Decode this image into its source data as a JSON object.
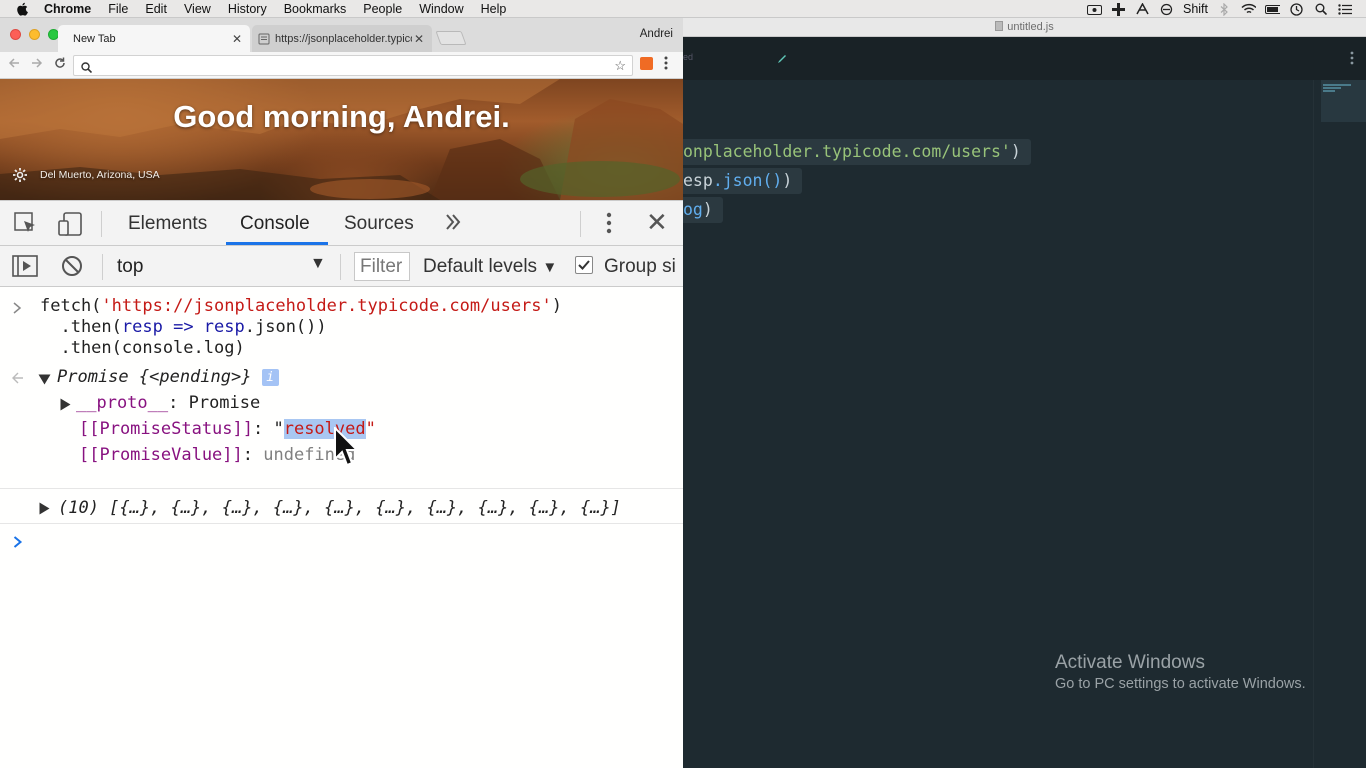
{
  "menubar": {
    "app_name": "Chrome",
    "items": [
      "File",
      "Edit",
      "View",
      "History",
      "Bookmarks",
      "People",
      "Window",
      "Help"
    ],
    "shift_label": "Shift"
  },
  "browser": {
    "tabs": [
      {
        "label": "New Tab",
        "active": true
      },
      {
        "label": "https://jsonplaceholder.typicode.com",
        "active": false
      }
    ],
    "profile_name": "Andrei",
    "address_value": ""
  },
  "newtab_page": {
    "greeting": "Good morning, Andrei.",
    "location": "Del Muerto, Arizona, USA"
  },
  "devtools": {
    "tabs": [
      "Elements",
      "Console",
      "Sources"
    ],
    "active_tab": "Console",
    "context": "top",
    "filter_placeholder": "Filter",
    "levels": "Default levels",
    "group_label": "Group si",
    "group_checked": true
  },
  "console": {
    "input_line1_fn": "fetch(",
    "input_line1_url": "'https://jsonplaceholder.typicode.com/users'",
    "input_line1_end": ")",
    "input_line2_a": "  .then(",
    "input_line2_b": "resp",
    "input_line2_c": " => ",
    "input_line2_d": "resp",
    "input_line2_e": ".json())",
    "input_line3": "  .then(console.log)",
    "promise_label": "Promise {<pending>}",
    "info_badge": "i",
    "proto_key": "__proto__",
    "proto_val": ": Promise",
    "status_key": "[[PromiseStatus]]",
    "status_sep": ": \"",
    "status_val": "resolved",
    "status_end": "\"",
    "value_key": "[[PromiseValue]]",
    "value_sep": ": ",
    "value_val": "undefined",
    "array_summary": "(10) [{…}, {…}, {…}, {…}, {…}, {…}, {…}, {…}, {…}, {…}]"
  },
  "editor": {
    "file_title": "untitled.js",
    "tab_fragment": "ed",
    "line1_str": "onplaceholder.typicode.com/users'",
    "line1_end": ")",
    "line2_a": "esp",
    "line2_b": ".json()",
    "line2_c": ")",
    "line3_a": "og",
    "line3_b": ")"
  },
  "watermark": {
    "title": "Activate Windows",
    "subtitle": "Go to PC settings to activate Windows."
  },
  "colors": {
    "console_string": "#c41a16",
    "console_property": "#881280",
    "editor_background": "#1e2a30",
    "editor_string": "#98c379",
    "editor_function": "#61aeee",
    "devtools_active_underline": "#1a73e8"
  }
}
